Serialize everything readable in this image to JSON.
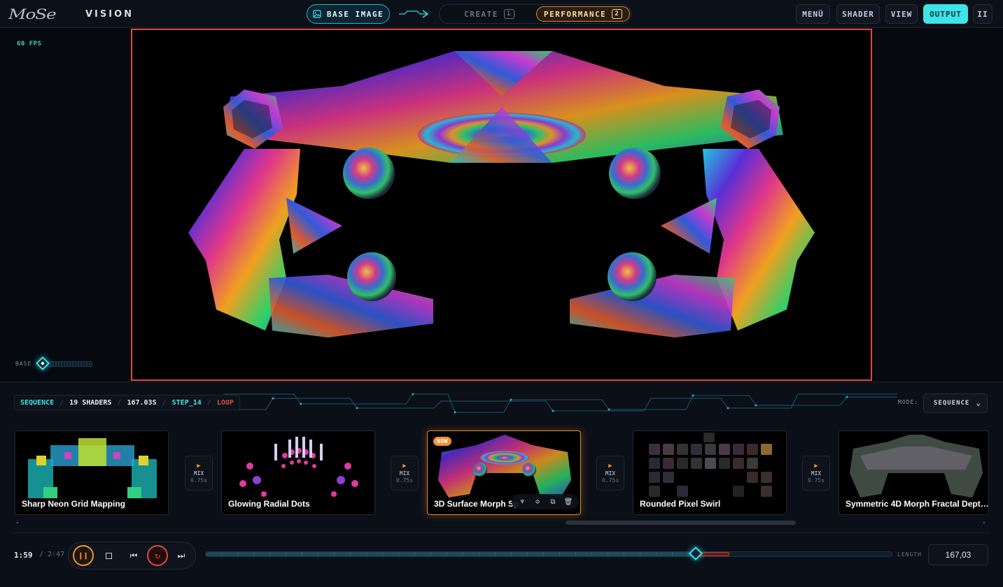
{
  "app": {
    "logo_text": "VISION",
    "logo_mark": "MoSe"
  },
  "header": {
    "base_image_label": "BASE IMAGE",
    "tabs": [
      {
        "label": "CREATE",
        "num": "1"
      },
      {
        "label": "PERFORMANCE",
        "num": "2"
      }
    ],
    "nav": {
      "menu": "MENÜ",
      "shader": "SHADER",
      "view": "VIEW",
      "output": "OUTPUT",
      "pause": "II"
    }
  },
  "stage": {
    "fps": "60 FPS",
    "base_label": "BASE",
    "base_level": 0
  },
  "sequence": {
    "label": "SEQUENCE",
    "shaders": "19 SHADERS",
    "duration": "167.03S",
    "step": "STEP_14",
    "loop": "LOOP",
    "mode_label": "MODE:",
    "mode_value": "SEQUENCE"
  },
  "cards": [
    {
      "title": "Sharp Neon Grid Mapping",
      "active": false
    },
    {
      "title": "Glowing Radial Dots",
      "active": false
    },
    {
      "title": "3D Surface Morph Sp",
      "active": true,
      "badge": "NOW"
    },
    {
      "title": "Rounded Pixel Swirl",
      "active": false
    },
    {
      "title": "Symmetric 4D Morph Fractal Depth ...",
      "active": false
    }
  ],
  "mix": [
    {
      "label": "MIX",
      "time": "0.75s"
    },
    {
      "label": "MIX",
      "time": "0.75s"
    },
    {
      "label": "MIX",
      "time": "0.75s"
    },
    {
      "label": "MIX",
      "time": "0.75s"
    }
  ],
  "transport": {
    "current": "1:59",
    "total": "/ 2:47",
    "progress": 0.713,
    "length_label": "LENGTH",
    "length_value": "167,03"
  },
  "colors": {
    "accent_cyan": "#3fe3ea",
    "accent_orange": "#f0913a",
    "accent_red": "#e0493f"
  }
}
